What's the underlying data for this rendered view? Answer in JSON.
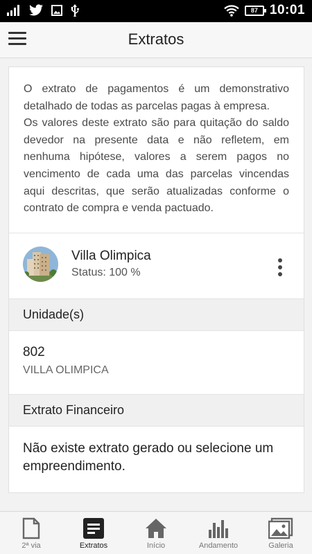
{
  "status_bar": {
    "time": "10:01",
    "battery": "87",
    "icons": [
      "signal-icon",
      "twitter-icon",
      "image-icon",
      "usb-icon",
      "wifi-icon",
      "battery-icon"
    ]
  },
  "header": {
    "title": "Extratos",
    "menu_icon": "hamburger-menu-icon"
  },
  "intro": {
    "paragraph1": "O extrato de pagamentos é um demonstrativo detalhado de todas as parcelas pagas à empresa.",
    "paragraph2": "Os valores deste extrato são para quitação do saldo devedor na presente data e não refletem, em nenhuma hipótese, valores a serem pagos no vencimento de cada uma das parcelas vincendas aqui descritas, que serão atualizadas conforme o contrato de compra e venda pactuado."
  },
  "project": {
    "name": "Villa Olimpica",
    "status": "Status: 100 %"
  },
  "units_section": {
    "title": "Unidade(s)",
    "unit_number": "802",
    "unit_name": "VILLA OLIMPICA"
  },
  "statement_section": {
    "title": "Extrato Financeiro",
    "empty_message": "Não existe extrato gerado ou selecione um empreendimento."
  },
  "bottom_nav": {
    "items": [
      {
        "label": "2ª via",
        "icon": "document-icon"
      },
      {
        "label": "Extratos",
        "icon": "statement-icon",
        "active": true
      },
      {
        "label": "Início",
        "icon": "home-icon"
      },
      {
        "label": "Andamento",
        "icon": "bar-chart-icon"
      },
      {
        "label": "Galeria",
        "icon": "gallery-icon"
      }
    ]
  }
}
